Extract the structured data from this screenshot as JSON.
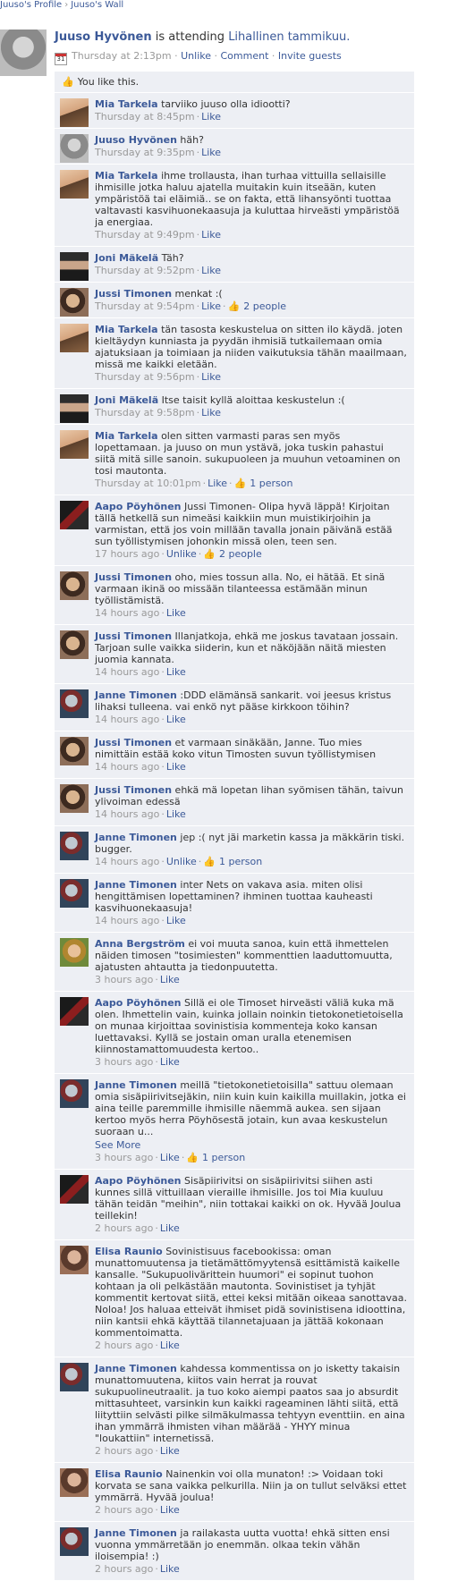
{
  "breadcrumb": {
    "profile": "Juuso's Profile",
    "separator": "›",
    "wall": "Juuso's Wall"
  },
  "story": {
    "actor": "Juuso Hyvönen",
    "action": " is attending ",
    "event": "Lihallinen tammikuu.",
    "calendar_day": "31",
    "time": "Thursday at 2:13pm",
    "unlike": "Unlike",
    "comment": "Comment",
    "invite": "Invite guests"
  },
  "likes_row": "You like this.",
  "comments": [
    {
      "author": "Mia Tarkela",
      "avatar": "av-mia",
      "text": "tarviiko juuso olla idiootti?",
      "time": "Thursday at 8:45pm",
      "actions": [
        "Like"
      ],
      "likes": ""
    },
    {
      "author": "Juuso Hyvönen",
      "avatar": "av-juuso",
      "text": "häh?",
      "time": "Thursday at 9:35pm",
      "actions": [
        "Like"
      ],
      "likes": ""
    },
    {
      "author": "Mia Tarkela",
      "avatar": "av-mia",
      "text": "ihme trollausta, ihan turhaa vittuilla sellaisille ihmisille jotka haluu ajatella muitakin kuin itseään, kuten ympäristöä tai eläimiä.. se on fakta, että lihansyönti tuottaa valtavasti kasvihuonekaasuja ja kuluttaa hirveästi ympäristöä ja energiaa.",
      "time": "Thursday at 9:49pm",
      "actions": [
        "Like"
      ],
      "likes": ""
    },
    {
      "author": "Joni Mäkelä",
      "avatar": "av-joni",
      "text": "Täh?",
      "time": "Thursday at 9:52pm",
      "actions": [
        "Like"
      ],
      "likes": ""
    },
    {
      "author": "Jussi Timonen",
      "avatar": "av-jussi",
      "text": "menkat :(",
      "time": "Thursday at 9:54pm",
      "actions": [
        "Like"
      ],
      "likes": "2 people"
    },
    {
      "author": "Mia Tarkela",
      "avatar": "av-mia",
      "text": "tän tasosta keskustelua on sitten ilo käydä. joten kieltäydyn kunniasta ja pyydän ihmisiä tutkailemaan omia ajatuksiaan ja toimiaan ja niiden vaikutuksia tähän maailmaan, missä me kaikki eletään.",
      "time": "Thursday at 9:56pm",
      "actions": [
        "Like"
      ],
      "likes": ""
    },
    {
      "author": "Joni Mäkelä",
      "avatar": "av-joni",
      "text": "Itse taisit kyllä aloittaa keskustelun :(",
      "time": "Thursday at 9:58pm",
      "actions": [
        "Like"
      ],
      "likes": ""
    },
    {
      "author": "Mia Tarkela",
      "avatar": "av-mia",
      "text": "olen sitten varmasti paras sen myös lopettamaan. ja juuso on mun ystävä, joka tuskin pahastui siitä mitä sille sanoin. sukupuoleen ja muuhun vetoaminen on tosi mautonta.",
      "time": "Thursday at 10:01pm",
      "actions": [
        "Like"
      ],
      "likes": "1 person"
    },
    {
      "author": "Aapo Pöyhönen",
      "avatar": "av-aapo",
      "text": "Jussi Timonen- Olipa hyvä läppä! Kirjoitan tällä hetkellä sun nimeäsi kaikkiin mun muistikirjoihin ja varmistan, että jos voin millään tavalla jonain päivänä estää sun työllistymisen johonkin missä olen, teen sen.",
      "time": "17 hours ago",
      "actions": [
        "Unlike"
      ],
      "likes": "2 people"
    },
    {
      "author": "Jussi Timonen",
      "avatar": "av-jussi",
      "text": "oho, mies tossun alla. No, ei hätää. Et sinä varmaan ikinä oo missään tilanteessa estämään minun työllistämistä.",
      "time": "14 hours ago",
      "actions": [
        "Like"
      ],
      "likes": ""
    },
    {
      "author": "Jussi Timonen",
      "avatar": "av-jussi",
      "text": "Illanjatkoja, ehkä me joskus tavataan jossain. Tarjoan sulle vaikka siiderin, kun et näköjään näitä miesten juomia kannata.",
      "time": "14 hours ago",
      "actions": [
        "Like"
      ],
      "likes": ""
    },
    {
      "author": "Janne Timonen",
      "avatar": "av-janne",
      "text": ":DDD elämänsä sankarit. voi jeesus kristus lihaksi tulleena. vai enkö nyt pääse kirkkoon töihin?",
      "time": "14 hours ago",
      "actions": [
        "Like"
      ],
      "likes": ""
    },
    {
      "author": "Jussi Timonen",
      "avatar": "av-jussi",
      "text": "et varmaan sinäkään, Janne. Tuo mies nimittäin estää koko vitun Timosten suvun työllistymisen",
      "time": "14 hours ago",
      "actions": [
        "Like"
      ],
      "likes": ""
    },
    {
      "author": "Jussi Timonen",
      "avatar": "av-jussi",
      "text": "ehkä mä lopetan lihan syömisen tähän, taivun ylivoiman edessä",
      "time": "14 hours ago",
      "actions": [
        "Like"
      ],
      "likes": ""
    },
    {
      "author": "Janne Timonen",
      "avatar": "av-janne",
      "text": "jep :( nyt jäi marketin kassa ja mäkkärin tiski. bugger.",
      "time": "14 hours ago",
      "actions": [
        "Unlike"
      ],
      "likes": "1 person"
    },
    {
      "author": "Janne Timonen",
      "avatar": "av-janne",
      "text": "inter Nets on vakava asia. miten olisi hengittämisen lopettaminen? ihminen tuottaa kauheasti kasvihuonekaasuja!",
      "time": "14 hours ago",
      "actions": [
        "Like"
      ],
      "likes": ""
    },
    {
      "author": "Anna Bergström",
      "avatar": "av-anna",
      "text": "ei voi muuta sanoa, kuin että ihmettelen näiden timosen \"tosimiesten\" kommenttien laaduttomuutta, ajatusten ahtautta ja tiedonpuutetta.",
      "time": "3 hours ago",
      "actions": [
        "Like"
      ],
      "likes": ""
    },
    {
      "author": "Aapo Pöyhönen",
      "avatar": "av-aapo",
      "text": "Sillä ei ole Timoset hirveästi väliä kuka mä olen. Ihmettelin vain, kuinka jollain noinkin tietokonetietoisella on munaa kirjoittaa sovinistisia kommenteja koko kansan luettavaksi. Kyllä se jostain oman uralla etenemisen kiinnostamattomuudesta kertoo..",
      "time": "3 hours ago",
      "actions": [
        "Like"
      ],
      "likes": ""
    },
    {
      "author": "Janne Timonen",
      "avatar": "av-janne",
      "text": "meillä \"tietokonetietoisilla\" sattuu olemaan omia sisäpiirivitsejäkin, niin kuin kuin kaikilla muillakin, jotka ei aina teille paremmille ihmisille näemmä aukea. sen sijaan kertoo myös herra Pöyhösestä jotain, kun avaa keskustelun suoraan u...",
      "see_more": "See More",
      "time": "3 hours ago",
      "actions": [
        "Like"
      ],
      "likes": "1 person"
    },
    {
      "author": "Aapo Pöyhönen",
      "avatar": "av-aapo",
      "text": "Sisäpiirivitsi on sisäpiirivitsi siihen asti kunnes sillä vittuillaan vieraille ihmisille. Jos toi Mia kuuluu tähän teidän \"meihin\", niin tottakai kaikki on ok. Hyvää Joulua teillekin!",
      "time": "2 hours ago",
      "actions": [
        "Like"
      ],
      "likes": ""
    },
    {
      "author": "Elisa Raunio",
      "avatar": "av-elisa",
      "text": "Sovinistisuus facebookissa: oman munattomuutensa ja tietämättömyytensä esittämistä kaikelle kansalle. \"Sukupuolivärittein huumori\" ei sopinut tuohon kohtaan ja oli pelkästään mautonta. Sovinistiset ja tyhjät kommentit kertovat siitä, ettei keksi mitään oikeaa sanottavaa. Noloa! Jos haluaa etteivät ihmiset pidä sovinistisena idioottina, niin kantsii ehkä käyttää tilannetajuaan ja jättää kokonaan kommentoimatta.",
      "time": "2 hours ago",
      "actions": [
        "Like"
      ],
      "likes": ""
    },
    {
      "author": "Janne Timonen",
      "avatar": "av-janne",
      "text": "kahdessa kommentissa on jo isketty takaisin munattomuutena, kiitos vain herrat ja rouvat sukupuolineutraalit. ja tuo koko aiempi paatos saa jo absurdit mittasuhteet, varsinkin kun kaikki rageaminen lähti siitä, että liityttiin selvästi pilke silmäkulmassa tehtyyn eventtiin. en aina ihan ymmärrä ihmisten vihan määrää - YHYY minua \"loukattiin\" internetissä.",
      "time": "2 hours ago",
      "actions": [
        "Like"
      ],
      "likes": ""
    },
    {
      "author": "Elisa Raunio",
      "avatar": "av-elisa",
      "text": "Nainenkin voi olla munaton! :> Voidaan toki korvata se sana vaikka pelkurilla. Niin ja on tullut selväksi ettet ymmärrä. Hyvää joulua!",
      "time": "2 hours ago",
      "actions": [
        "Like"
      ],
      "likes": ""
    },
    {
      "author": "Janne Timonen",
      "avatar": "av-janne",
      "text": "ja railakasta uutta vuotta! ehkä sitten ensi vuonna ymmärretään jo enemmän. olkaa tekin vähän iloisempia! :)",
      "time": "2 hours ago",
      "actions": [
        "Like"
      ],
      "likes": ""
    }
  ]
}
